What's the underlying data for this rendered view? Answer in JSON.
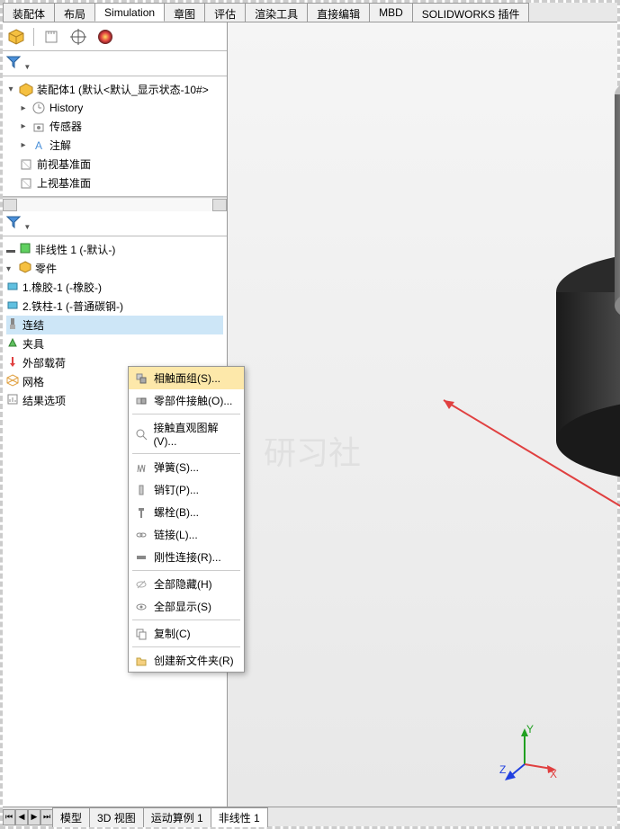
{
  "tabs_top": [
    "装配体",
    "布局",
    "Simulation",
    "章图",
    "评估",
    "渲染工具",
    "直接编辑",
    "MBD",
    "SOLIDWORKS 插件"
  ],
  "active_top_tab": 2,
  "assembly_title": "装配体1 (默认<默认_显示状态-10#>",
  "feature_tree": {
    "history": "History",
    "sensors": "传感器",
    "annotations": "注解",
    "front_plane": "前视基准面",
    "top_plane": "上视基准面"
  },
  "study_tree": {
    "study_name": "非线性 1 (-默认-)",
    "parts_label": "零件",
    "part1": "1.橡胶-1 (-橡胶-)",
    "part2": "2.铁柱-1 (-普通碳钢-)",
    "connections": "连结",
    "fixtures": "夹具",
    "loads": "外部载荷",
    "mesh": "网格",
    "results": "结果选项"
  },
  "context_menu": {
    "contact_set": "相触面组(S)...",
    "component_contact": "零部件接触(O)...",
    "contact_visualization": "接触直观图解(V)...",
    "spring": "弹簧(S)...",
    "pin": "销钉(P)...",
    "bolt": "螺栓(B)...",
    "link": "链接(L)...",
    "rigid": "刚性连接(R)...",
    "hide_all": "全部隐藏(H)",
    "show_all": "全部显示(S)",
    "copy": "复制(C)",
    "new_folder": "创建新文件夹(R)"
  },
  "bottom_tabs": [
    "模型",
    "3D 视图",
    "运动算例 1",
    "非线性 1"
  ],
  "active_bottom_tab": 3,
  "watermark": "研习社"
}
